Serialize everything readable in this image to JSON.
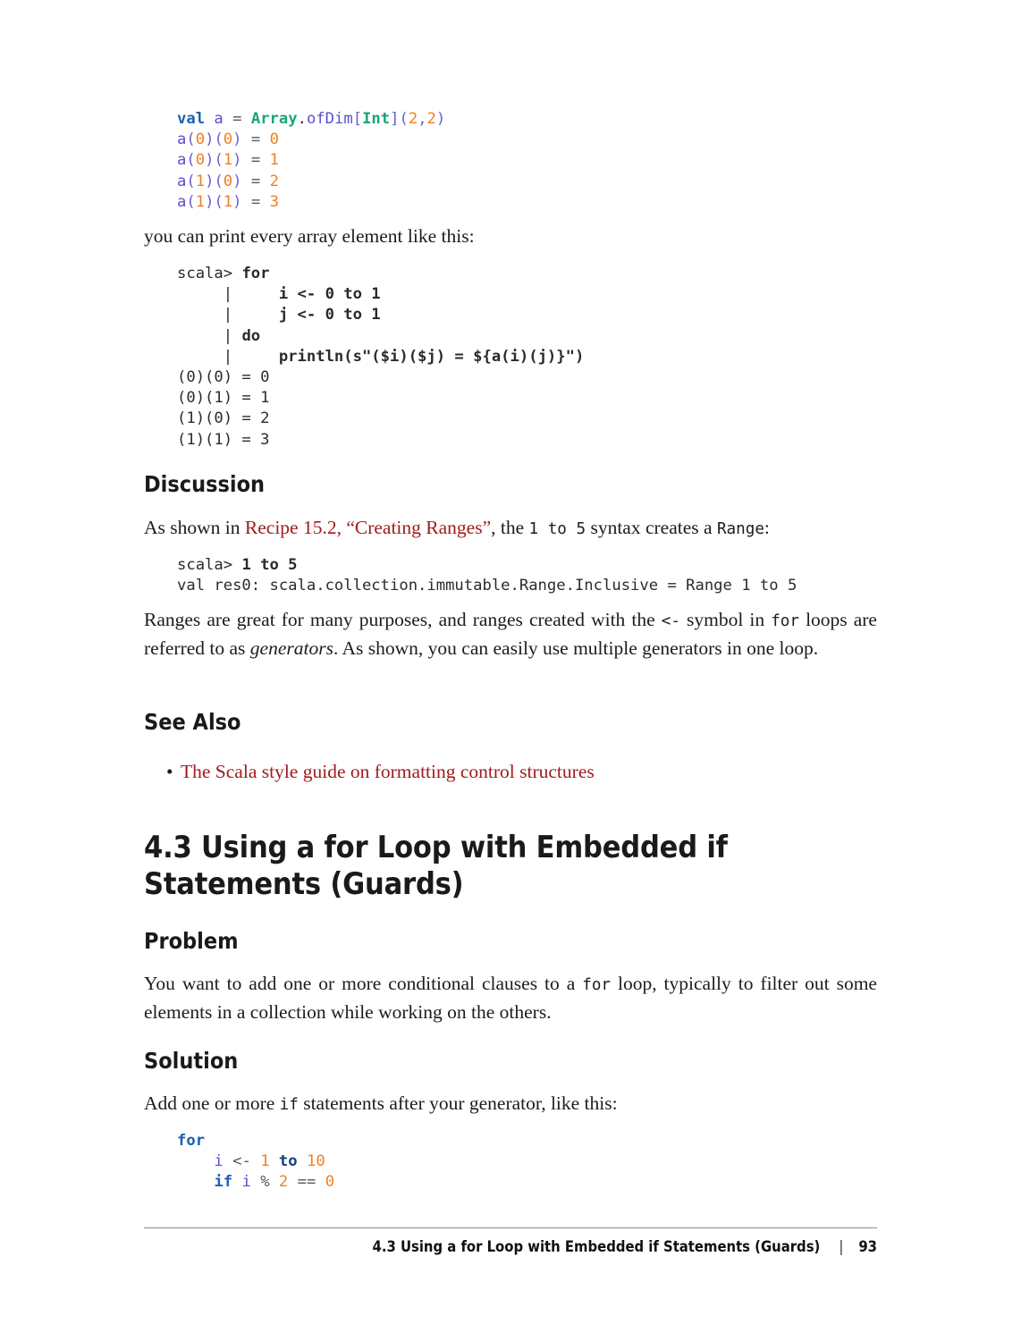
{
  "page": {
    "number": "93",
    "footer_title": "4.3 Using a for Loop with Embedded if Statements (Guards)",
    "footer_separator": "|"
  },
  "code_block_1": {
    "name": "array-ofdim-code",
    "lines": [
      [
        {
          "t": "val",
          "c": "kw"
        },
        {
          "t": " ",
          "c": "plain"
        },
        {
          "t": "a",
          "c": "ident"
        },
        {
          "t": " ",
          "c": "plain"
        },
        {
          "t": "=",
          "c": "op"
        },
        {
          "t": " ",
          "c": "plain"
        },
        {
          "t": "Array",
          "c": "cls"
        },
        {
          "t": ".",
          "c": "plain"
        },
        {
          "t": "ofDim",
          "c": "ident"
        },
        {
          "t": "[",
          "c": "punct"
        },
        {
          "t": "Int",
          "c": "type"
        },
        {
          "t": "]",
          "c": "punct"
        },
        {
          "t": "(",
          "c": "punct"
        },
        {
          "t": "2",
          "c": "num"
        },
        {
          "t": ",",
          "c": "punct"
        },
        {
          "t": "2",
          "c": "num"
        },
        {
          "t": ")",
          "c": "punct"
        }
      ],
      [
        {
          "t": "a",
          "c": "ident"
        },
        {
          "t": "(",
          "c": "punct"
        },
        {
          "t": "0",
          "c": "num"
        },
        {
          "t": ")",
          "c": "punct"
        },
        {
          "t": "(",
          "c": "punct"
        },
        {
          "t": "0",
          "c": "num"
        },
        {
          "t": ")",
          "c": "punct"
        },
        {
          "t": " ",
          "c": "plain"
        },
        {
          "t": "=",
          "c": "op"
        },
        {
          "t": " ",
          "c": "plain"
        },
        {
          "t": "0",
          "c": "num"
        }
      ],
      [
        {
          "t": "a",
          "c": "ident"
        },
        {
          "t": "(",
          "c": "punct"
        },
        {
          "t": "0",
          "c": "num"
        },
        {
          "t": ")",
          "c": "punct"
        },
        {
          "t": "(",
          "c": "punct"
        },
        {
          "t": "1",
          "c": "num"
        },
        {
          "t": ")",
          "c": "punct"
        },
        {
          "t": " ",
          "c": "plain"
        },
        {
          "t": "=",
          "c": "op"
        },
        {
          "t": " ",
          "c": "plain"
        },
        {
          "t": "1",
          "c": "num"
        }
      ],
      [
        {
          "t": "a",
          "c": "ident"
        },
        {
          "t": "(",
          "c": "punct"
        },
        {
          "t": "1",
          "c": "num"
        },
        {
          "t": ")",
          "c": "punct"
        },
        {
          "t": "(",
          "c": "punct"
        },
        {
          "t": "0",
          "c": "num"
        },
        {
          "t": ")",
          "c": "punct"
        },
        {
          "t": " ",
          "c": "plain"
        },
        {
          "t": "=",
          "c": "op"
        },
        {
          "t": " ",
          "c": "plain"
        },
        {
          "t": "2",
          "c": "num"
        }
      ],
      [
        {
          "t": "a",
          "c": "ident"
        },
        {
          "t": "(",
          "c": "punct"
        },
        {
          "t": "1",
          "c": "num"
        },
        {
          "t": ")",
          "c": "punct"
        },
        {
          "t": "(",
          "c": "punct"
        },
        {
          "t": "1",
          "c": "num"
        },
        {
          "t": ")",
          "c": "punct"
        },
        {
          "t": " ",
          "c": "plain"
        },
        {
          "t": "=",
          "c": "op"
        },
        {
          "t": " ",
          "c": "plain"
        },
        {
          "t": "3",
          "c": "num"
        }
      ]
    ]
  },
  "para_print": {
    "text": "you can print every array element like this:"
  },
  "code_block_2": {
    "name": "repl-for-loop-code",
    "lines": [
      [
        {
          "t": "scala> ",
          "c": "plain"
        },
        {
          "t": "for",
          "c": "plain b"
        }
      ],
      [
        {
          "t": "     |     ",
          "c": "plain"
        },
        {
          "t": "i <- 0 to 1",
          "c": "plain b"
        }
      ],
      [
        {
          "t": "     |     ",
          "c": "plain"
        },
        {
          "t": "j <- 0 to 1",
          "c": "plain b"
        }
      ],
      [
        {
          "t": "     | ",
          "c": "plain"
        },
        {
          "t": "do",
          "c": "plain b"
        }
      ],
      [
        {
          "t": "     |     ",
          "c": "plain"
        },
        {
          "t": "println(s\"($i)($j) = ${a(i)(j)}\")",
          "c": "plain b"
        }
      ],
      [
        {
          "t": "(0)(0) = 0",
          "c": "plain"
        }
      ],
      [
        {
          "t": "(0)(1) = 1",
          "c": "plain"
        }
      ],
      [
        {
          "t": "(1)(0) = 2",
          "c": "plain"
        }
      ],
      [
        {
          "t": "(1)(1) = 3",
          "c": "plain"
        }
      ]
    ]
  },
  "discussion": {
    "heading": "Discussion",
    "para": {
      "pre": "As shown in ",
      "link": "Recipe 15.2, “Creating Ranges”",
      "mid": ", the ",
      "code1": "1  to  5",
      "mid2": " syntax creates a ",
      "code2": "Range",
      "post": ":"
    }
  },
  "code_block_3": {
    "name": "range-repl-code",
    "lines": [
      [
        {
          "t": "scala> ",
          "c": "plain"
        },
        {
          "t": "1 to 5",
          "c": "plain b"
        }
      ],
      [
        {
          "t": "val res0: scala.collection.immutable.Range.Inclusive = Range 1 to 5",
          "c": "plain"
        }
      ]
    ]
  },
  "para_ranges": {
    "s1": "Ranges are great for many purposes, and ranges created with the ",
    "c1": "<-",
    "s2": " symbol in ",
    "c2": "for",
    "s3": " loops are referred to as ",
    "i1": "generators",
    "s4": ". As shown, you can easily use multiple generators in one loop."
  },
  "see_also": {
    "heading": "See Also",
    "bullet_glyph": "•",
    "items": [
      {
        "label": "The Scala style guide on formatting control structures"
      }
    ]
  },
  "recipe": {
    "title": "4.3 Using a for Loop with Embedded if Statements (Guards)",
    "problem": {
      "heading": "Problem",
      "s1": "You want to add one or more conditional clauses to a ",
      "c1": "for",
      "s2": " loop, typically to filter out some elements in a collection while working on the others."
    },
    "solution": {
      "heading": "Solution",
      "s1": "Add one or more ",
      "c1": "if",
      "s2": " statements after your generator, like this:"
    }
  },
  "code_block_4": {
    "name": "for-guard-code",
    "lines": [
      [
        {
          "t": "for",
          "c": "kw"
        }
      ],
      [
        {
          "t": "    ",
          "c": "plain"
        },
        {
          "t": "i",
          "c": "ident"
        },
        {
          "t": " ",
          "c": "plain"
        },
        {
          "t": "<-",
          "c": "op"
        },
        {
          "t": " ",
          "c": "plain"
        },
        {
          "t": "1",
          "c": "num"
        },
        {
          "t": " ",
          "c": "plain"
        },
        {
          "t": "to",
          "c": "kw2"
        },
        {
          "t": " ",
          "c": "plain"
        },
        {
          "t": "10",
          "c": "num"
        }
      ],
      [
        {
          "t": "    ",
          "c": "plain"
        },
        {
          "t": "if",
          "c": "kw"
        },
        {
          "t": " ",
          "c": "plain"
        },
        {
          "t": "i",
          "c": "ident"
        },
        {
          "t": " ",
          "c": "plain"
        },
        {
          "t": "%",
          "c": "op"
        },
        {
          "t": " ",
          "c": "plain"
        },
        {
          "t": "2",
          "c": "num"
        },
        {
          "t": " ",
          "c": "plain"
        },
        {
          "t": "==",
          "c": "op"
        },
        {
          "t": " ",
          "c": "plain"
        },
        {
          "t": "0",
          "c": "num"
        }
      ]
    ]
  },
  "colors": {
    "link": "#a01b1b",
    "keyword": "#1f5fb5",
    "type": "#1aa37a",
    "number": "#ef8023",
    "identifier": "#5a4fcf",
    "text": "#1c1c1c"
  }
}
